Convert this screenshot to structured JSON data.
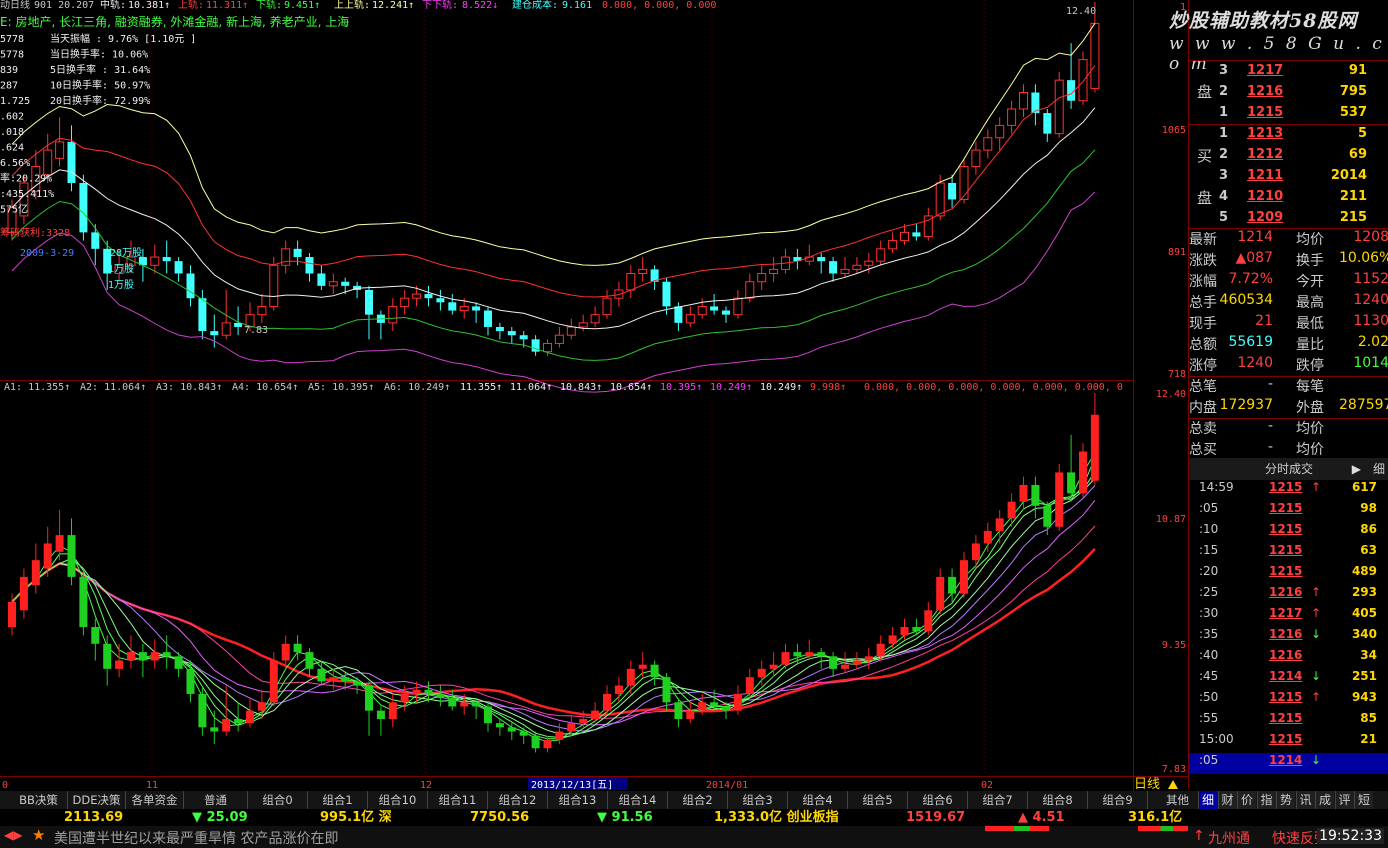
{
  "header": {
    "items": [
      {
        "text": "动日线",
        "color": "#c8c8c8"
      },
      {
        "text": "901 20.207",
        "color": "#c8c8c8"
      },
      {
        "text": "中轨:",
        "color": "#f0f0f0"
      },
      {
        "text": "10.381↑",
        "color": "#f0f0f0"
      },
      {
        "text": "上轨:",
        "color": "#ff4040"
      },
      {
        "text": "11.311↑",
        "color": "#ff4040"
      },
      {
        "text": "下轨:",
        "color": "#40ff40"
      },
      {
        "text": "9.451↑",
        "color": "#40ff40"
      },
      {
        "text": "上上轨:",
        "color": "#ffffa0"
      },
      {
        "text": "12.241↑",
        "color": "#ffffa0"
      },
      {
        "text": "下下轨:",
        "color": "#ff40ff"
      },
      {
        "text": "8.522↓",
        "color": "#ff40ff"
      },
      {
        "text": "建仓成本:",
        "color": "#40ffff"
      },
      {
        "text": "9.161",
        "color": "#40ffff"
      },
      {
        "text": "0.000, 0.000, 0.000",
        "color": "#ff4040"
      }
    ],
    "concepts": "E: 房地产, 长江三角, 融资融券, 外滩金融, 新上海, 养老产业, 上海"
  },
  "info_left": [
    "5778",
    "5778",
    "839",
    "287",
    "1.725",
    ".602",
    ".018",
    ".624",
    "6.56%",
    "率:20.29%",
    ":435.411%",
    "575亿"
  ],
  "info_right": [
    "当天振幅  : 9.76% [1.10元 ]",
    "当日换手率: 10.06%",
    "5日换手率 : 31.64%",
    "10日换手率: 50.97%",
    "20日换手率: 72.99%"
  ],
  "annotations": {
    "fund_in": "筹码获利:3328",
    "date_label": "2009-3-29",
    "shares_1": "828万股",
    "shares_2": "1万股",
    "shares_3": "1万股",
    "low_marker": "7.83",
    "high_marker": "12.40"
  },
  "price_axis": [
    "1",
    "1065",
    "891",
    "718"
  ],
  "lower_axis": [
    "12.40",
    "10.87",
    "9.35",
    "7.83"
  ],
  "ma_line": {
    "labels": [
      "A1: 11.355↑",
      "A2: 11.064↑",
      "A3: 10.843↑",
      "A4: 10.654↑",
      "A5: 10.395↑",
      "A6: 10.249↑",
      "11.355↑",
      "11.064↑",
      "10.843↑",
      "10.654↑",
      "10.395↑",
      "10.249↑",
      "10.249↑",
      "9.998↑",
      "0.000, 0.000, 0.000, 0.000, 0.000, 0.000, 0"
    ],
    "colors": [
      "#c8c8c8",
      "#c8c8c8",
      "#c8c8c8",
      "#c8c8c8",
      "#c8c8c8",
      "#c8c8c8",
      "#f0f0f0",
      "#f0f0f0",
      "#f0f0f0",
      "#f0f0f0",
      "#ff40ff",
      "#ff40ff",
      "#f0f0f0",
      "#ff4040",
      "#ff4040"
    ]
  },
  "date_axis": {
    "labels": [
      "0",
      "11",
      "12",
      "2014/01",
      "02"
    ],
    "cursor_date": "2013/12/13[五]",
    "period": "日线"
  },
  "right_panel": {
    "watermark_main": "炒股辅助教材58股网",
    "watermark_url": "w w w . 5 8 G u . c o m",
    "sell_label": "盘",
    "buy_label_1": "买",
    "buy_label_2": "盘",
    "sell": [
      {
        "n": "3",
        "p": "1217",
        "v": "91"
      },
      {
        "n": "2",
        "p": "1216",
        "v": "795"
      },
      {
        "n": "1",
        "p": "1215",
        "v": "537"
      }
    ],
    "buy": [
      {
        "n": "1",
        "p": "1213",
        "v": "5"
      },
      {
        "n": "2",
        "p": "1212",
        "v": "69"
      },
      {
        "n": "3",
        "p": "1211",
        "v": "2014"
      },
      {
        "n": "4",
        "p": "1210",
        "v": "211"
      },
      {
        "n": "5",
        "p": "1209",
        "v": "215"
      }
    ],
    "stats": [
      {
        "k": "最新",
        "v": "1214",
        "vc": "#ff4040",
        "k2": "均价",
        "v2": "1208",
        "v2c": "#ff4040"
      },
      {
        "k": "涨跌",
        "v": "▲087",
        "vc": "#ff4040",
        "k2": "换手",
        "v2": "10.06%",
        "v2c": "#ffd700"
      },
      {
        "k": "涨幅",
        "v": "7.72%",
        "vc": "#ff4040",
        "k2": "今开",
        "v2": "1152",
        "v2c": "#ff4040"
      },
      {
        "k": "总手",
        "v": "460534",
        "vc": "#ffd700",
        "k2": "最高",
        "v2": "1240",
        "v2c": "#ff4040"
      },
      {
        "k": "现手",
        "v": "21",
        "vc": "#ff4040",
        "k2": "最低",
        "v2": "1130",
        "v2c": "#ff4040"
      },
      {
        "k": "总额",
        "v": "55619",
        "vc": "#40ffff",
        "k2": "量比",
        "v2": "2.02",
        "v2c": "#ffd700"
      },
      {
        "k": "涨停",
        "v": "1240",
        "vc": "#ff4040",
        "k2": "跌停",
        "v2": "1014",
        "v2c": "#40ff40"
      },
      {
        "k": "总笔",
        "v": "-",
        "vc": "#ccc",
        "k2": "每笔",
        "v2": "",
        "v2c": "#ccc"
      },
      {
        "k": "内盘",
        "v": "172937",
        "vc": "#ffd700",
        "k2": "外盘",
        "v2": "287597",
        "v2c": "#ffd700"
      },
      {
        "k": "总卖",
        "v": "-",
        "vc": "#ccc",
        "k2": "均价",
        "v2": "",
        "v2c": "#ccc"
      },
      {
        "k": "总买",
        "v": "-",
        "vc": "#ccc",
        "k2": "均价",
        "v2": "",
        "v2c": "#ccc"
      }
    ],
    "ticks_title": "分时成交",
    "ticks_detail": "细",
    "ticks": [
      {
        "t": "14:59",
        "p": "1215",
        "ar": "↑",
        "ac": "#ff4040",
        "v": "617"
      },
      {
        "t": ":05",
        "p": "1215",
        "ar": "",
        "ac": "",
        "v": "98"
      },
      {
        "t": ":10",
        "p": "1215",
        "ar": "",
        "ac": "",
        "v": "86"
      },
      {
        "t": ":15",
        "p": "1215",
        "ar": "",
        "ac": "",
        "v": "63"
      },
      {
        "t": ":20",
        "p": "1215",
        "ar": "",
        "ac": "",
        "v": "489"
      },
      {
        "t": ":25",
        "p": "1216",
        "ar": "↑",
        "ac": "#ff4040",
        "v": "293"
      },
      {
        "t": ":30",
        "p": "1217",
        "ar": "↑",
        "ac": "#ff4040",
        "v": "405"
      },
      {
        "t": ":35",
        "p": "1216",
        "ar": "↓",
        "ac": "#40ff40",
        "v": "340"
      },
      {
        "t": ":40",
        "p": "1216",
        "ar": "",
        "ac": "",
        "v": "34"
      },
      {
        "t": ":45",
        "p": "1214",
        "ar": "↓",
        "ac": "#40ff40",
        "v": "251"
      },
      {
        "t": ":50",
        "p": "1215",
        "ar": "↑",
        "ac": "#ff4040",
        "v": "943"
      },
      {
        "t": ":55",
        "p": "1215",
        "ar": "",
        "ac": "",
        "v": "85"
      },
      {
        "t": "15:00",
        "p": "1215",
        "ar": "",
        "ac": "",
        "v": "21"
      },
      {
        "t": ":05",
        "p": "1214",
        "ar": "↓",
        "ac": "#40ff40",
        "v": ""
      }
    ],
    "side_tabs": [
      "细",
      "财",
      "价",
      "指",
      "势",
      "讯",
      "成",
      "评",
      "短"
    ]
  },
  "tabs": [
    "BB决策",
    "DDE决策",
    "各单资金",
    "普通",
    "组合0",
    "组合1",
    "组合10",
    "组合11",
    "组合12",
    "组合13",
    "组合14",
    "组合2",
    "组合3",
    "组合4",
    "组合5",
    "组合6",
    "组合7",
    "组合8",
    "组合9",
    "其他"
  ],
  "ticker": [
    {
      "t": "2113.69",
      "c": "#ffd700"
    },
    {
      "t": "▼ 25.09",
      "c": "#40ff40"
    },
    {
      "t": "995.1亿 深",
      "c": "#ffd700"
    },
    {
      "t": "7750.56",
      "c": "#ffd700"
    },
    {
      "t": "▼ 91.56",
      "c": "#40ff40"
    },
    {
      "t": "1,333.0亿 创业板指",
      "c": "#ffd700"
    },
    {
      "t": "1519.67",
      "c": "#ff4040"
    },
    {
      "t": "▲ 4.51",
      "c": "#ff4040"
    },
    {
      "t": "316.1亿",
      "c": "#ffd700"
    }
  ],
  "news": {
    "headline": "美国遭半世纪以来最严重旱情 农产品涨价在即",
    "alert_stock": "九州通",
    "alert_text": "快速反弹",
    "clock": "19:52:33"
  },
  "chart_data": {
    "type": "candlestick",
    "price_range": [
      7.83,
      12.4
    ],
    "candles": [
      {
        "o": 9.6,
        "c": 9.9,
        "h": 10.0,
        "l": 9.5
      },
      {
        "o": 9.8,
        "c": 10.2,
        "h": 10.3,
        "l": 9.7
      },
      {
        "o": 10.1,
        "c": 10.4,
        "h": 10.6,
        "l": 10.0
      },
      {
        "o": 10.3,
        "c": 10.6,
        "h": 10.8,
        "l": 10.2
      },
      {
        "o": 10.5,
        "c": 10.7,
        "h": 11.0,
        "l": 10.4
      },
      {
        "o": 10.7,
        "c": 10.2,
        "h": 10.9,
        "l": 10.1
      },
      {
        "o": 10.2,
        "c": 9.6,
        "h": 10.3,
        "l": 9.5
      },
      {
        "o": 9.6,
        "c": 9.4,
        "h": 9.7,
        "l": 9.2
      },
      {
        "o": 9.4,
        "c": 9.1,
        "h": 9.5,
        "l": 8.9
      },
      {
        "o": 9.1,
        "c": 9.2,
        "h": 9.4,
        "l": 9.0
      },
      {
        "o": 9.2,
        "c": 9.3,
        "h": 9.5,
        "l": 9.1
      },
      {
        "o": 9.3,
        "c": 9.2,
        "h": 9.4,
        "l": 9.0
      },
      {
        "o": 9.2,
        "c": 9.3,
        "h": 9.45,
        "l": 9.1
      },
      {
        "o": 9.3,
        "c": 9.25,
        "h": 9.5,
        "l": 9.1
      },
      {
        "o": 9.25,
        "c": 9.1,
        "h": 9.3,
        "l": 9.0
      },
      {
        "o": 9.1,
        "c": 8.8,
        "h": 9.2,
        "l": 8.7
      },
      {
        "o": 8.8,
        "c": 8.4,
        "h": 8.9,
        "l": 8.3
      },
      {
        "o": 8.4,
        "c": 8.35,
        "h": 8.6,
        "l": 8.2
      },
      {
        "o": 8.35,
        "c": 8.5,
        "h": 8.9,
        "l": 8.3
      },
      {
        "o": 8.5,
        "c": 8.45,
        "h": 8.7,
        "l": 8.35
      },
      {
        "o": 8.45,
        "c": 8.6,
        "h": 8.75,
        "l": 8.4
      },
      {
        "o": 8.6,
        "c": 8.7,
        "h": 8.85,
        "l": 8.5
      },
      {
        "o": 8.7,
        "c": 9.2,
        "h": 9.3,
        "l": 8.65
      },
      {
        "o": 9.2,
        "c": 9.4,
        "h": 9.5,
        "l": 9.1
      },
      {
        "o": 9.4,
        "c": 9.3,
        "h": 9.5,
        "l": 9.2
      },
      {
        "o": 9.3,
        "c": 9.1,
        "h": 9.35,
        "l": 9.0
      },
      {
        "o": 9.1,
        "c": 8.95,
        "h": 9.2,
        "l": 8.9
      },
      {
        "o": 8.95,
        "c": 9.0,
        "h": 9.1,
        "l": 8.85
      },
      {
        "o": 9.0,
        "c": 8.95,
        "h": 9.05,
        "l": 8.85
      },
      {
        "o": 8.95,
        "c": 8.9,
        "h": 9.0,
        "l": 8.8
      },
      {
        "o": 8.9,
        "c": 8.6,
        "h": 8.95,
        "l": 8.3
      },
      {
        "o": 8.6,
        "c": 8.5,
        "h": 8.65,
        "l": 8.3
      },
      {
        "o": 8.5,
        "c": 8.7,
        "h": 8.8,
        "l": 8.4
      },
      {
        "o": 8.7,
        "c": 8.8,
        "h": 8.9,
        "l": 8.6
      },
      {
        "o": 8.8,
        "c": 8.85,
        "h": 8.95,
        "l": 8.7
      },
      {
        "o": 8.85,
        "c": 8.8,
        "h": 8.95,
        "l": 8.7
      },
      {
        "o": 8.8,
        "c": 8.75,
        "h": 8.9,
        "l": 8.65
      },
      {
        "o": 8.75,
        "c": 8.65,
        "h": 8.85,
        "l": 8.6
      },
      {
        "o": 8.65,
        "c": 8.7,
        "h": 8.8,
        "l": 8.55
      },
      {
        "o": 8.7,
        "c": 8.65,
        "h": 8.75,
        "l": 8.5
      },
      {
        "o": 8.65,
        "c": 8.45,
        "h": 8.7,
        "l": 8.35
      },
      {
        "o": 8.45,
        "c": 8.4,
        "h": 8.5,
        "l": 8.3
      },
      {
        "o": 8.4,
        "c": 8.35,
        "h": 8.45,
        "l": 8.25
      },
      {
        "o": 8.35,
        "c": 8.3,
        "h": 8.4,
        "l": 8.2
      },
      {
        "o": 8.3,
        "c": 8.15,
        "h": 8.35,
        "l": 8.1
      },
      {
        "o": 8.15,
        "c": 8.25,
        "h": 8.3,
        "l": 8.1
      },
      {
        "o": 8.25,
        "c": 8.35,
        "h": 8.45,
        "l": 8.2
      },
      {
        "o": 8.35,
        "c": 8.45,
        "h": 8.55,
        "l": 8.3
      },
      {
        "o": 8.45,
        "c": 8.5,
        "h": 8.6,
        "l": 8.4
      },
      {
        "o": 8.5,
        "c": 8.6,
        "h": 8.7,
        "l": 8.45
      },
      {
        "o": 8.6,
        "c": 8.8,
        "h": 8.9,
        "l": 8.55
      },
      {
        "o": 8.8,
        "c": 8.9,
        "h": 9.0,
        "l": 8.7
      },
      {
        "o": 8.9,
        "c": 9.1,
        "h": 9.2,
        "l": 8.8
      },
      {
        "o": 9.1,
        "c": 9.15,
        "h": 9.3,
        "l": 9.0
      },
      {
        "o": 9.15,
        "c": 9.0,
        "h": 9.2,
        "l": 8.9
      },
      {
        "o": 9.0,
        "c": 8.7,
        "h": 9.05,
        "l": 8.6
      },
      {
        "o": 8.7,
        "c": 8.5,
        "h": 8.75,
        "l": 8.4
      },
      {
        "o": 8.5,
        "c": 8.6,
        "h": 8.7,
        "l": 8.45
      },
      {
        "o": 8.6,
        "c": 8.7,
        "h": 8.8,
        "l": 8.55
      },
      {
        "o": 8.7,
        "c": 8.65,
        "h": 8.85,
        "l": 8.6
      },
      {
        "o": 8.65,
        "c": 8.6,
        "h": 8.7,
        "l": 8.5
      },
      {
        "o": 8.6,
        "c": 8.8,
        "h": 8.9,
        "l": 8.55
      },
      {
        "o": 8.8,
        "c": 9.0,
        "h": 9.1,
        "l": 8.75
      },
      {
        "o": 9.0,
        "c": 9.1,
        "h": 9.2,
        "l": 8.9
      },
      {
        "o": 9.1,
        "c": 9.15,
        "h": 9.3,
        "l": 9.0
      },
      {
        "o": 9.15,
        "c": 9.3,
        "h": 9.4,
        "l": 9.1
      },
      {
        "o": 9.3,
        "c": 9.25,
        "h": 9.4,
        "l": 9.15
      },
      {
        "o": 9.25,
        "c": 9.3,
        "h": 9.45,
        "l": 9.2
      },
      {
        "o": 9.3,
        "c": 9.25,
        "h": 9.35,
        "l": 9.1
      },
      {
        "o": 9.25,
        "c": 9.1,
        "h": 9.3,
        "l": 9.0
      },
      {
        "o": 9.1,
        "c": 9.15,
        "h": 9.3,
        "l": 9.05
      },
      {
        "o": 9.15,
        "c": 9.2,
        "h": 9.3,
        "l": 9.1
      },
      {
        "o": 9.2,
        "c": 9.25,
        "h": 9.35,
        "l": 9.1
      },
      {
        "o": 9.25,
        "c": 9.4,
        "h": 9.5,
        "l": 9.2
      },
      {
        "o": 9.4,
        "c": 9.5,
        "h": 9.6,
        "l": 9.35
      },
      {
        "o": 9.5,
        "c": 9.6,
        "h": 9.7,
        "l": 9.45
      },
      {
        "o": 9.6,
        "c": 9.55,
        "h": 9.7,
        "l": 9.5
      },
      {
        "o": 9.55,
        "c": 9.8,
        "h": 9.9,
        "l": 9.5
      },
      {
        "o": 9.8,
        "c": 10.2,
        "h": 10.3,
        "l": 9.75
      },
      {
        "o": 10.2,
        "c": 10.0,
        "h": 10.3,
        "l": 9.9
      },
      {
        "o": 10.0,
        "c": 10.4,
        "h": 10.5,
        "l": 9.95
      },
      {
        "o": 10.4,
        "c": 10.6,
        "h": 10.7,
        "l": 10.3
      },
      {
        "o": 10.6,
        "c": 10.75,
        "h": 10.85,
        "l": 10.5
      },
      {
        "o": 10.75,
        "c": 10.9,
        "h": 11.0,
        "l": 10.6
      },
      {
        "o": 10.9,
        "c": 11.1,
        "h": 11.2,
        "l": 10.8
      },
      {
        "o": 11.1,
        "c": 11.3,
        "h": 11.4,
        "l": 11.0
      },
      {
        "o": 11.3,
        "c": 11.05,
        "h": 11.4,
        "l": 10.9
      },
      {
        "o": 11.05,
        "c": 10.8,
        "h": 11.1,
        "l": 10.7
      },
      {
        "o": 10.8,
        "c": 11.45,
        "h": 11.55,
        "l": 10.75
      },
      {
        "o": 11.45,
        "c": 11.2,
        "h": 11.9,
        "l": 11.1
      },
      {
        "o": 11.2,
        "c": 11.7,
        "h": 11.8,
        "l": 11.15
      },
      {
        "o": 11.35,
        "c": 12.14,
        "h": 12.4,
        "l": 11.3
      }
    ]
  }
}
